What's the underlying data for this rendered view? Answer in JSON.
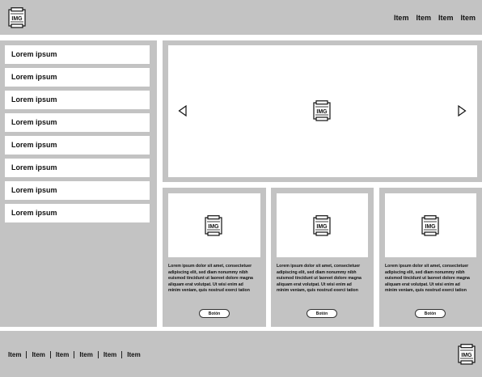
{
  "header": {
    "logo_icon": "img-placeholder-icon",
    "logo_text": "IMG",
    "nav": [
      "Item",
      "Item",
      "Item",
      "Item"
    ]
  },
  "sidebar": {
    "items": [
      "Lorem ipsum",
      "Lorem ipsum",
      "Lorem ipsum",
      "Lorem ipsum",
      "Lorem ipsum",
      "Lorem ipsum",
      "Lorem ipsum",
      "Lorem ipsum"
    ]
  },
  "slider": {
    "image_text": "IMG",
    "prev_icon": "triangle-left-icon",
    "next_icon": "triangle-right-icon"
  },
  "cards": [
    {
      "image_text": "IMG",
      "lines": [
        "Lorem ipsum dolor sit amet, consectetuer",
        "adipiscing elit, sed diam nonummy nibh",
        "euismod tincidunt ut laoreet dolore magna",
        "aliquam erat volutpat. Ut wisi enim ad",
        "minim veniam, quis nostrud exerci tation"
      ],
      "button": "Botón"
    },
    {
      "image_text": "IMG",
      "lines": [
        "Lorem ipsum dolor sit amet, consectetuer",
        "adipiscing elit, sed diam nonummy nibh",
        "euismod tincidunt ut laoreet dolore magna",
        "aliquam erat volutpat. Ut wisi enim ad",
        "minim veniam, quis nostrud exerci tation"
      ],
      "button": "Botón"
    },
    {
      "image_text": "IMG",
      "lines": [
        "Lorem ipsum dolor sit amet, consectetuer",
        "adipiscing elit, sed diam nonummy nibh",
        "euismod tincidunt ut laoreet dolore magna",
        "aliquam erat volutpat. Ut wisi enim ad",
        "minim veniam, quis nostrud exerci tation"
      ],
      "button": "Botón"
    }
  ],
  "footer": {
    "nav": [
      "Item",
      "Item",
      "Item",
      "Item",
      "Item",
      "Item"
    ],
    "logo_text": "IMG"
  },
  "colors": {
    "panel_gray": "#c3c3c3",
    "background": "#ffffff",
    "ink": "#111111"
  }
}
